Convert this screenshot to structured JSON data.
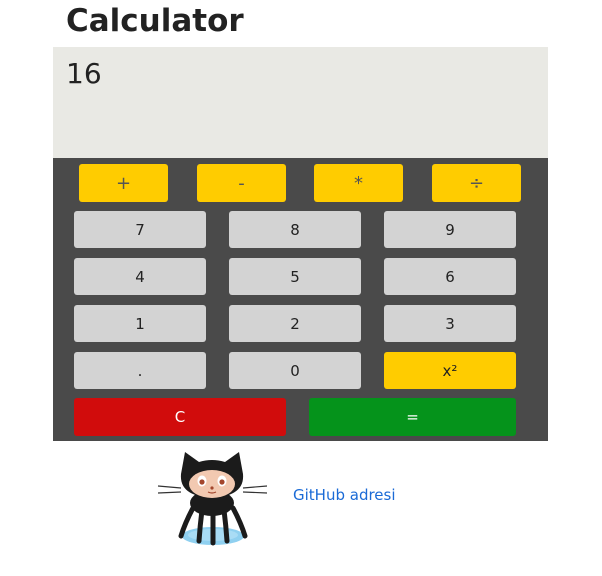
{
  "app": {
    "title": "Calculator"
  },
  "display": {
    "value": "16"
  },
  "operators": [
    {
      "label": "+"
    },
    {
      "label": "-"
    },
    {
      "label": "*"
    },
    {
      "label": "÷"
    }
  ],
  "keys": {
    "k7": "7",
    "k8": "8",
    "k9": "9",
    "k4": "4",
    "k5": "5",
    "k6": "6",
    "k1": "1",
    "k2": "2",
    "k3": "3",
    "dot": ".",
    "k0": "0",
    "square": "x²"
  },
  "actions": {
    "clear": "C",
    "equals": "="
  },
  "footer": {
    "link_text": "GitHub adresi",
    "logo_icon": "octocat-icon"
  },
  "colors": {
    "operator": "#ffcc00",
    "number": "#d3d3d3",
    "keypad_bg": "#4a4a4a",
    "display_bg": "#e9e9e4",
    "clear": "#d10c0c",
    "equals": "#05931b",
    "link": "#1a6ad6"
  }
}
